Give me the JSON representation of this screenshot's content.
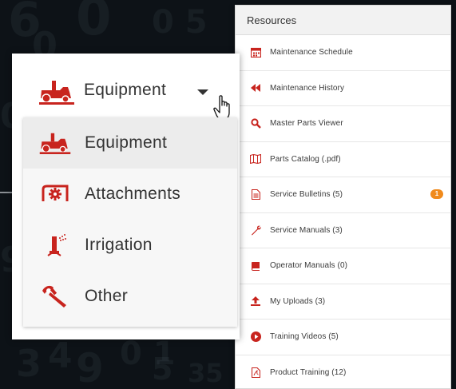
{
  "colors": {
    "accent_red": "#c8241e",
    "badge_orange": "#f08a1c",
    "text": "#333333",
    "background": "#0d1217"
  },
  "resources": {
    "title": "Resources",
    "items": [
      {
        "label": "Maintenance Schedule",
        "icon": "calendar-icon"
      },
      {
        "label": "Maintenance History",
        "icon": "rewind-icon"
      },
      {
        "label": "Master Parts Viewer",
        "icon": "search-icon"
      },
      {
        "label": "Parts Catalog (.pdf)",
        "icon": "map-icon"
      },
      {
        "label": "Service Bulletins (5)",
        "icon": "document-icon",
        "badge": "1"
      },
      {
        "label": "Service Manuals (3)",
        "icon": "wrench-icon"
      },
      {
        "label": "Operator Manuals (0)",
        "icon": "book-icon"
      },
      {
        "label": "My Uploads (3)",
        "icon": "upload-icon"
      },
      {
        "label": "Training Videos (5)",
        "icon": "play-icon"
      },
      {
        "label": "Product Training (12)",
        "icon": "pdf-icon"
      }
    ]
  },
  "equipment_selector": {
    "selected": "Equipment",
    "options": [
      {
        "label": "Equipment",
        "icon": "mower-icon"
      },
      {
        "label": "Attachments",
        "icon": "attachment-gear-icon"
      },
      {
        "label": "Irrigation",
        "icon": "sprinkler-icon"
      },
      {
        "label": "Other",
        "icon": "blower-icon"
      }
    ]
  }
}
